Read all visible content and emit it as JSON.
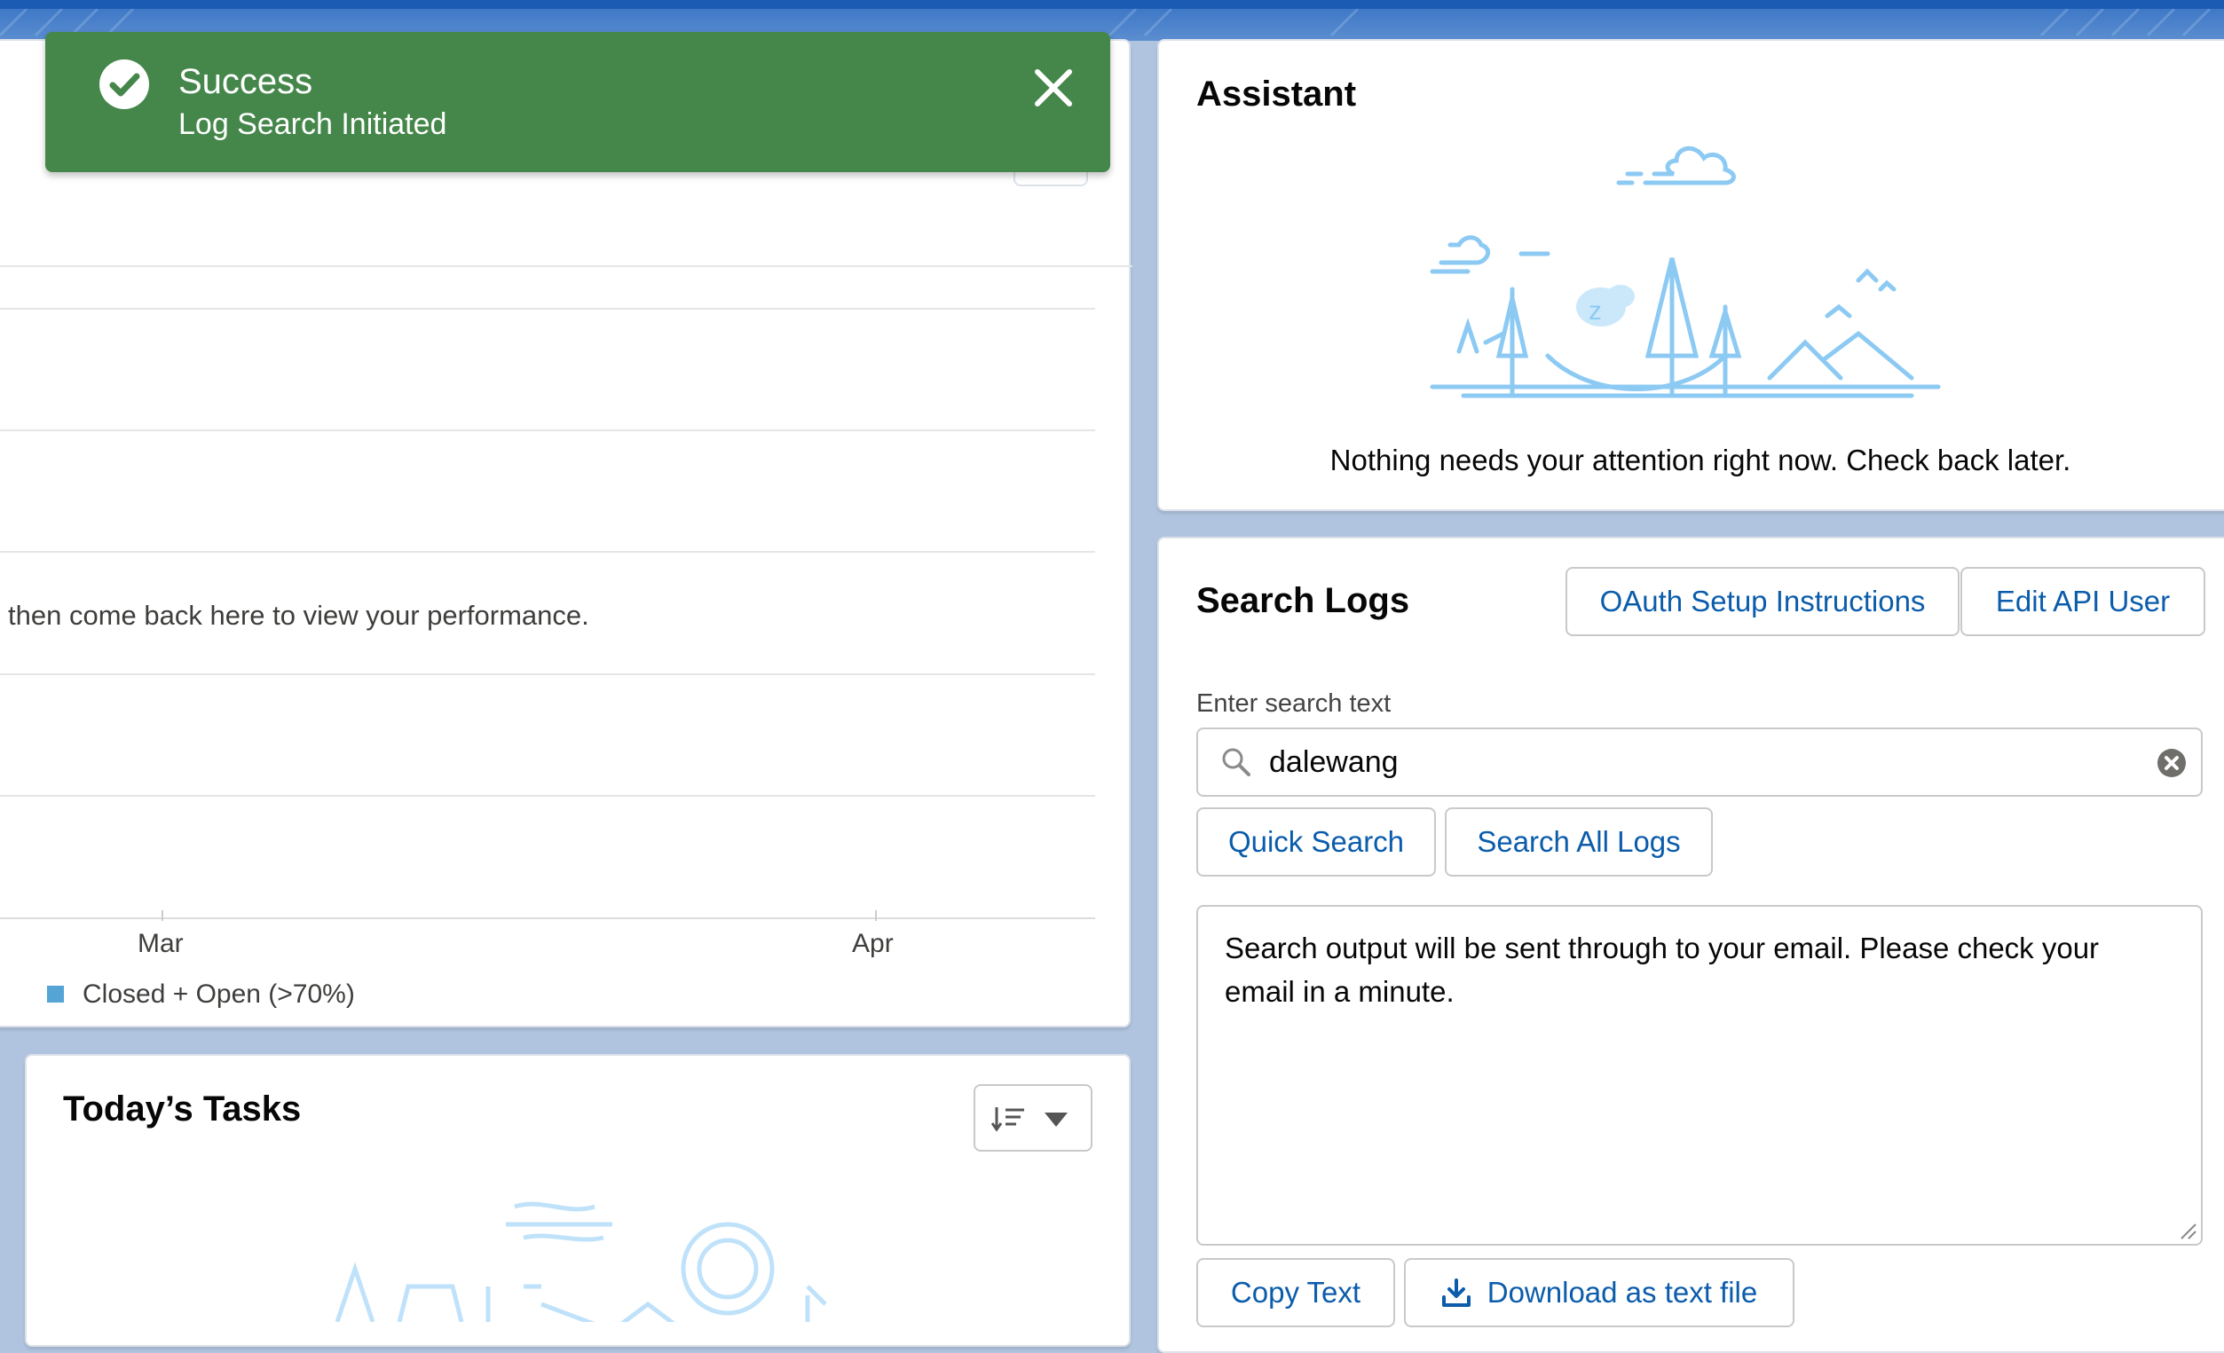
{
  "toast": {
    "title": "Success",
    "message": "Log Search Initiated"
  },
  "left_chart": {
    "empty_message": "then come back here to view your performance.",
    "x_ticks": [
      "Mar",
      "Apr"
    ],
    "legend": "Closed + Open (>70%)",
    "legend_color": "#54a4d5"
  },
  "tasks": {
    "title": "Today’s Tasks"
  },
  "assistant": {
    "title": "Assistant",
    "message": "Nothing needs your attention right now. Check back later."
  },
  "search_logs": {
    "title": "Search Logs",
    "oauth_button": "OAuth Setup Instructions",
    "edit_api_button": "Edit API User",
    "input_label": "Enter search text",
    "input_value": "dalewang",
    "quick_search_button": "Quick Search",
    "search_all_button": "Search All Logs",
    "output_text": "Search output will be sent through to your email. Please check your email in a minute.",
    "copy_button": "Copy Text",
    "download_button": "Download as text file"
  },
  "colors": {
    "brand": "#0b5cab",
    "success": "#45874a",
    "illustration": "#8ccaf3"
  }
}
